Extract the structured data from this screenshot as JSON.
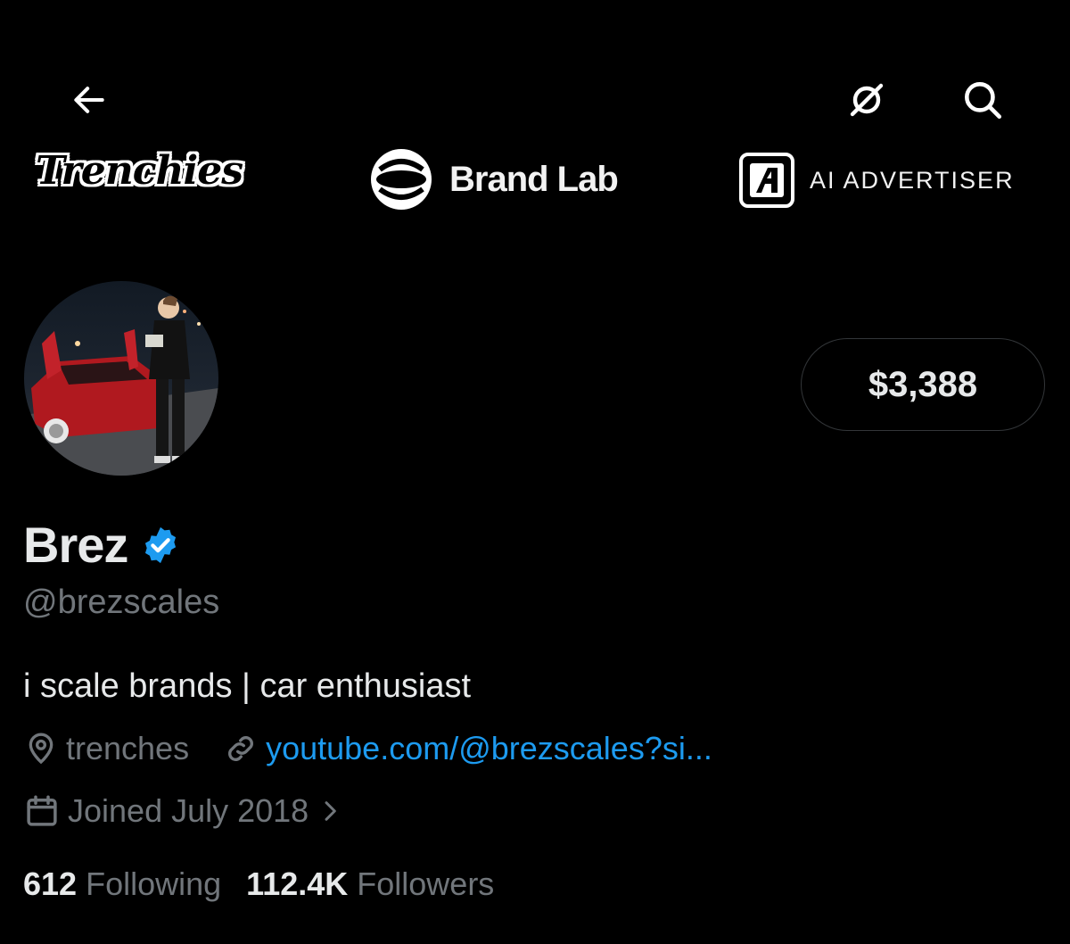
{
  "header": {
    "back_icon": "arrow-left-icon",
    "grok_icon": "grok-icon",
    "search_icon": "search-icon"
  },
  "banner": {
    "logo1": "Trenchies",
    "logo2": "Brand Lab",
    "logo3": "AI ADVERTISER"
  },
  "profile": {
    "name": "Brez",
    "handle": "@brezscales",
    "bio": "i scale brands | car enthusiast",
    "location": "trenches",
    "website": "youtube.com/@brezscales?si...",
    "joined": "Joined July 2018",
    "tip_amount": "$3,388",
    "verified_color": "#1d9bf0"
  },
  "stats": {
    "following_count": "612",
    "following_label": "Following",
    "followers_count": "112.4K",
    "followers_label": "Followers"
  },
  "colors": {
    "background": "#000000",
    "text_primary": "#e7e9ea",
    "text_secondary": "#71767b",
    "link": "#1d9bf0"
  }
}
